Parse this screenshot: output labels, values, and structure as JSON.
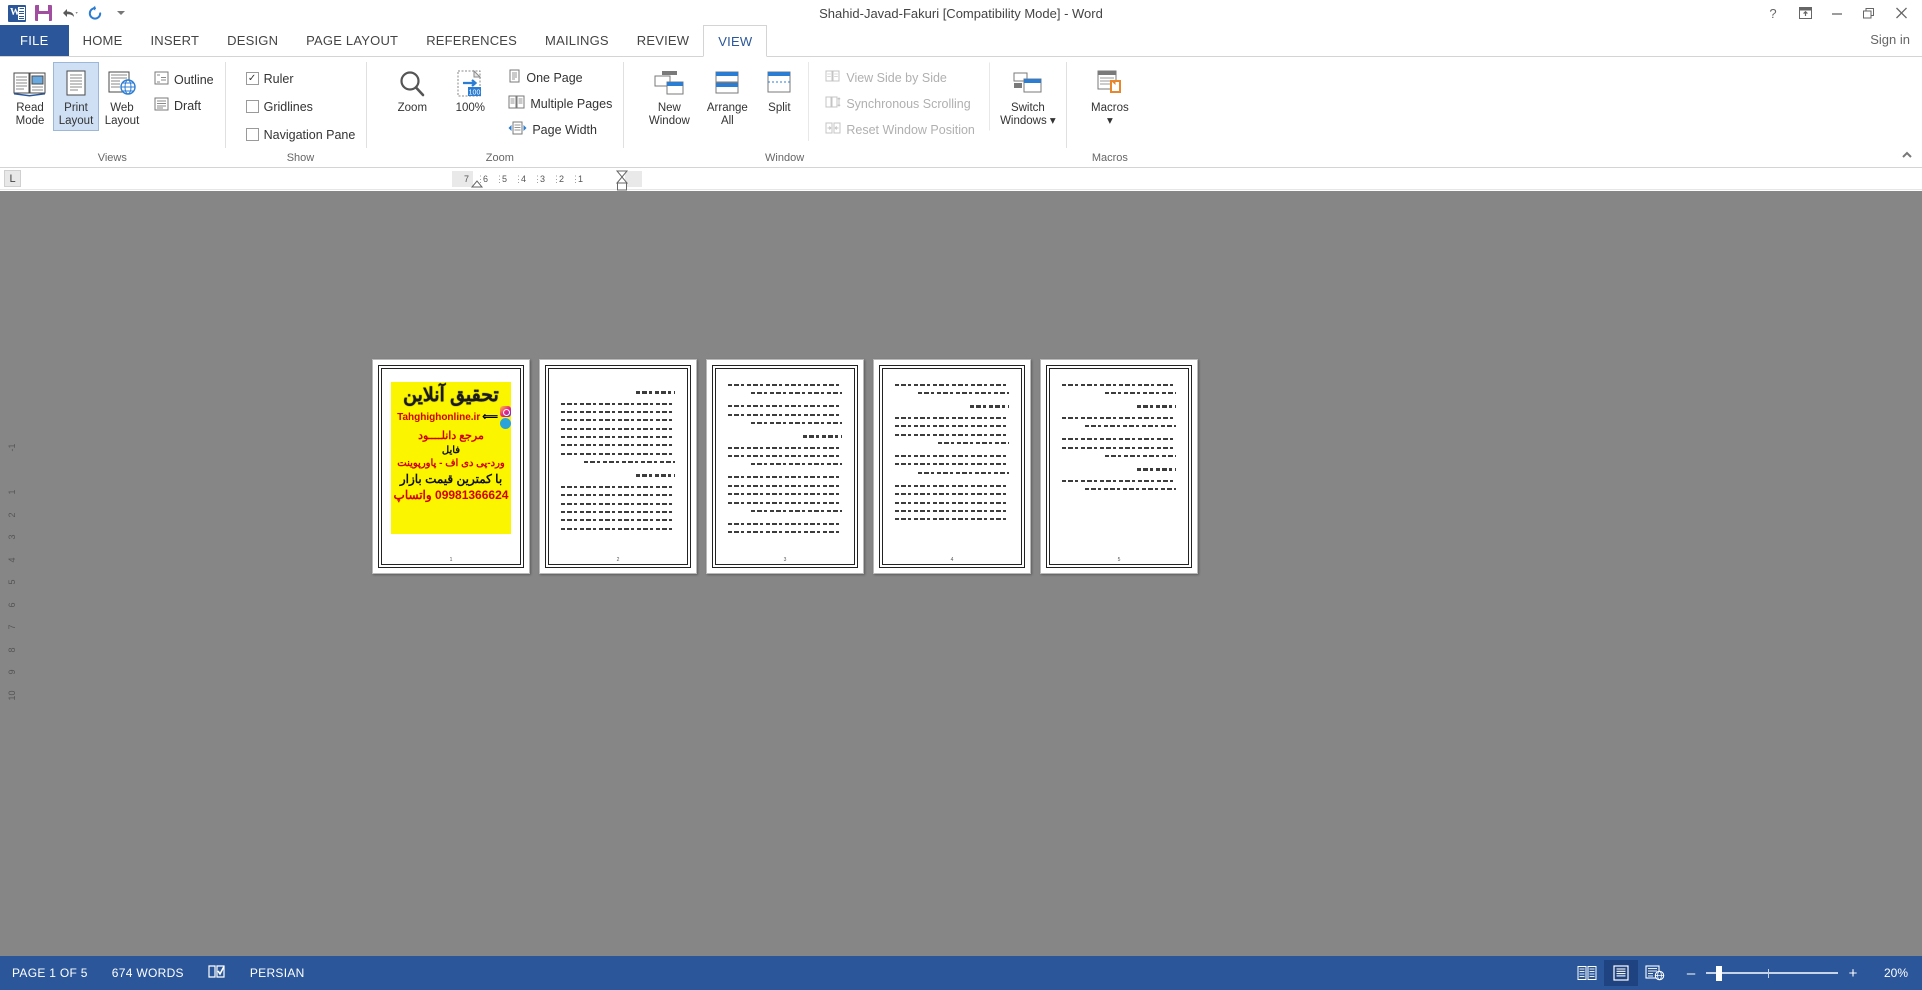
{
  "window": {
    "title": "Shahid-Javad-Fakuri [Compatibility Mode] - Word",
    "help_icon": "?",
    "ribbon_display_icon": "ribbon-display-options-icon",
    "minimize_icon": "—",
    "restore_icon": "❐",
    "close_icon": "✕",
    "sign_in": "Sign in"
  },
  "quick_access": {
    "word_icon": "word-logo-icon",
    "save_icon": "save-icon",
    "undo_icon": "undo-icon",
    "redo_icon": "redo-icon",
    "customize_icon": "customize-quick-access-icon"
  },
  "tabs": [
    {
      "label": "FILE",
      "active": false
    },
    {
      "label": "HOME",
      "active": false
    },
    {
      "label": "INSERT",
      "active": false
    },
    {
      "label": "DESIGN",
      "active": false
    },
    {
      "label": "PAGE LAYOUT",
      "active": false
    },
    {
      "label": "REFERENCES",
      "active": false
    },
    {
      "label": "MAILINGS",
      "active": false
    },
    {
      "label": "REVIEW",
      "active": false
    },
    {
      "label": "VIEW",
      "active": true
    }
  ],
  "ribbon": {
    "groups": [
      {
        "name": "Views",
        "label": "Views",
        "buttons": [
          {
            "label_1": "Read",
            "label_2": "Mode",
            "selected": false
          },
          {
            "label_1": "Print",
            "label_2": "Layout",
            "selected": true
          },
          {
            "label_1": "Web",
            "label_2": "Layout",
            "selected": false
          }
        ],
        "small": [
          {
            "label": "Outline"
          },
          {
            "label": "Draft"
          }
        ]
      },
      {
        "name": "Show",
        "label": "Show",
        "checkboxes": [
          {
            "label": "Ruler",
            "checked": true
          },
          {
            "label": "Gridlines",
            "checked": false
          },
          {
            "label": "Navigation Pane",
            "checked": false
          }
        ]
      },
      {
        "name": "Zoom",
        "label": "Zoom",
        "buttons": [
          {
            "label_1": "Zoom",
            "label_2": ""
          },
          {
            "label_1": "100%",
            "label_2": ""
          }
        ],
        "small": [
          {
            "label": "One Page"
          },
          {
            "label": "Multiple Pages"
          },
          {
            "label": "Page Width"
          }
        ]
      },
      {
        "name": "Window",
        "label": "Window",
        "buttons": [
          {
            "label_1": "New",
            "label_2": "Window"
          },
          {
            "label_1": "Arrange",
            "label_2": "All"
          },
          {
            "label_1": "Split",
            "label_2": ""
          }
        ],
        "small_disabled": [
          {
            "label": "View Side by Side"
          },
          {
            "label": "Synchronous Scrolling"
          },
          {
            "label": "Reset Window Position"
          }
        ],
        "buttons2": [
          {
            "label_1": "Switch",
            "label_2": "Windows ▾"
          }
        ]
      },
      {
        "name": "Macros",
        "label": "Macros",
        "buttons": [
          {
            "label_1": "Macros",
            "label_2": "▾"
          }
        ]
      }
    ],
    "collapse_icon": "▲"
  },
  "ruler": {
    "tab_selector": "L",
    "horizontal_numbers": [
      "7",
      "6",
      "5",
      "4",
      "3",
      "2",
      "1"
    ],
    "vertical_numbers": [
      "-1",
      "",
      "1",
      "2",
      "3",
      "4",
      "5",
      "6",
      "7",
      "8",
      "9",
      "10"
    ]
  },
  "document": {
    "page_count": 5,
    "pages": [
      {
        "number": "1",
        "type": "ad",
        "ad": {
          "heading": "تحقیق آنلاین",
          "site": "Tahghighonline.ir",
          "line3": "مرجع دانلــــود",
          "line4": "فایل",
          "line5": "ورد-پی دی اف - پاورپوینت",
          "line6": "با کمترین قیمت بازار",
          "line7": "09981366624 واتساپ",
          "bg_color": "#fbf500",
          "text_color": "#d30000",
          "instagram_icon": "instagram-icon",
          "telegram_icon": "telegram-icon",
          "arrow_icon": "left-arrow-icon"
        }
      },
      {
        "number": "2",
        "type": "text"
      },
      {
        "number": "3",
        "type": "text"
      },
      {
        "number": "4",
        "type": "text"
      },
      {
        "number": "5",
        "type": "text"
      }
    ]
  },
  "status_bar": {
    "page_indicator": "PAGE 1 OF 5",
    "word_count": "674 WORDS",
    "proofing_icon": "proofing-errors-icon",
    "language": "PERSIAN",
    "view_read_mode_icon": "read-mode-icon",
    "view_print_layout_icon": "print-layout-icon",
    "view_web_layout_icon": "web-layout-icon",
    "zoom_out_icon": "–",
    "zoom_in_icon": "+",
    "zoom_level": "20%"
  }
}
